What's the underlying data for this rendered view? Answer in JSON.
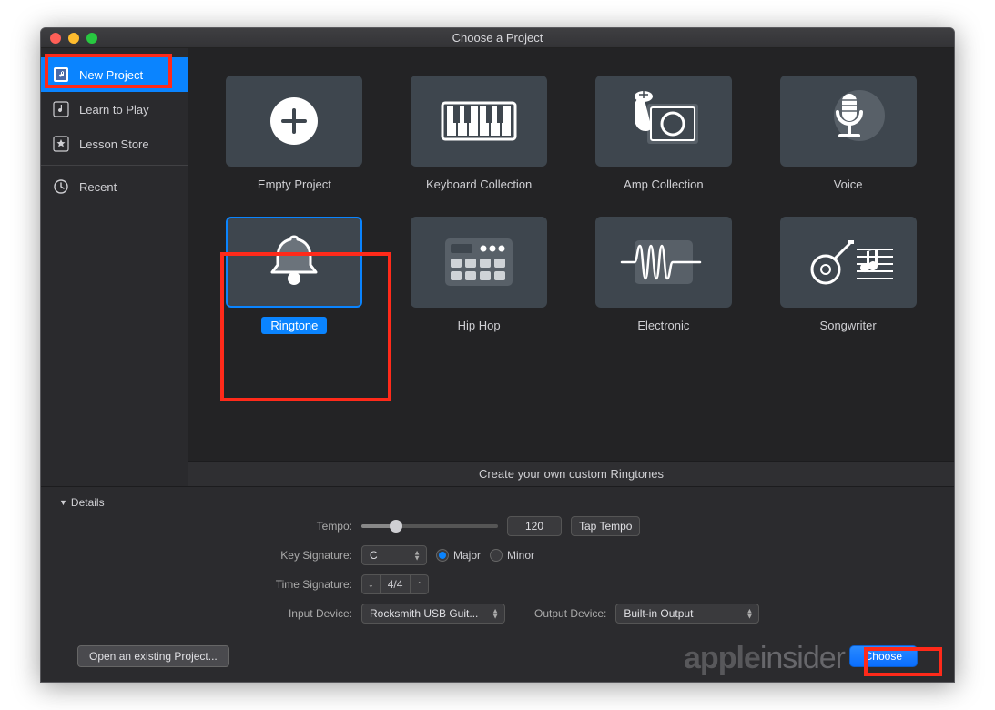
{
  "window": {
    "title": "Choose a Project"
  },
  "sidebar": {
    "items": [
      {
        "label": "New Project"
      },
      {
        "label": "Learn to Play"
      },
      {
        "label": "Lesson Store"
      },
      {
        "label": "Recent"
      }
    ]
  },
  "templates": [
    {
      "label": "Empty Project"
    },
    {
      "label": "Keyboard Collection"
    },
    {
      "label": "Amp Collection"
    },
    {
      "label": "Voice"
    },
    {
      "label": "Ringtone"
    },
    {
      "label": "Hip Hop"
    },
    {
      "label": "Electronic"
    },
    {
      "label": "Songwriter"
    }
  ],
  "description": "Create your own custom Ringtones",
  "details": {
    "header": "Details",
    "tempo_label": "Tempo:",
    "tempo_value": "120",
    "tap_tempo": "Tap Tempo",
    "key_sig_label": "Key Signature:",
    "key_value": "C",
    "major": "Major",
    "minor": "Minor",
    "time_sig_label": "Time Signature:",
    "time_value": "4/4",
    "input_device_label": "Input Device:",
    "input_device_value": "Rocksmith USB Guit...",
    "output_device_label": "Output Device:",
    "output_device_value": "Built-in Output"
  },
  "buttons": {
    "open": "Open an existing Project...",
    "choose": "Choose"
  },
  "watermark": {
    "a": "apple",
    "b": "insider"
  }
}
